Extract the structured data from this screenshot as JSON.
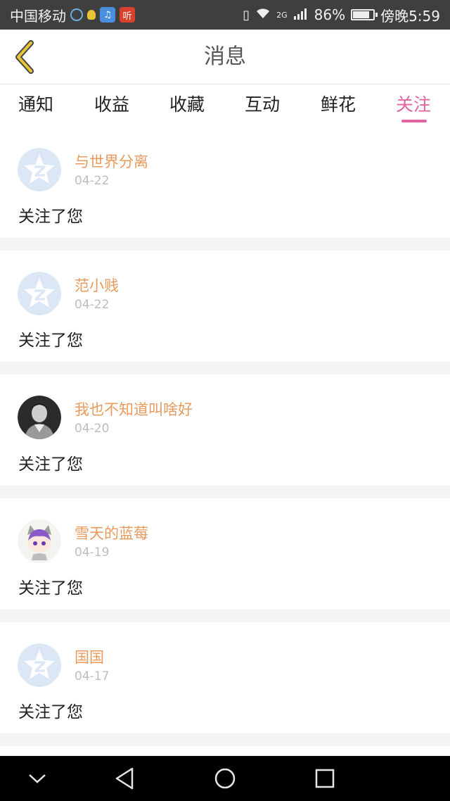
{
  "status_bar": {
    "carrier": "中国移动",
    "network": "2G",
    "battery": "86%",
    "time": "傍晚5:59",
    "app_icon_label": "听"
  },
  "header": {
    "title": "消息"
  },
  "tabs": [
    {
      "label": "通知",
      "active": false
    },
    {
      "label": "收益",
      "active": false
    },
    {
      "label": "收藏",
      "active": false
    },
    {
      "label": "互动",
      "active": false
    },
    {
      "label": "鲜花",
      "active": false
    },
    {
      "label": "关注",
      "active": true
    }
  ],
  "notifications": [
    {
      "username": "与世界分离",
      "date": "04-22",
      "action": "关注了您",
      "avatar": "default-star"
    },
    {
      "username": "范小贱",
      "date": "04-22",
      "action": "关注了您",
      "avatar": "default-star"
    },
    {
      "username": "我也不知道叫啥好",
      "date": "04-20",
      "action": "关注了您",
      "avatar": "photo-man"
    },
    {
      "username": "雪天的蓝莓",
      "date": "04-19",
      "action": "关注了您",
      "avatar": "anime-character"
    },
    {
      "username": "国国",
      "date": "04-17",
      "action": "关注了您",
      "avatar": "default-star"
    }
  ],
  "colors": {
    "accent": "#e062a3",
    "username": "#e89a5f",
    "back_arrow": "#e8c437"
  }
}
